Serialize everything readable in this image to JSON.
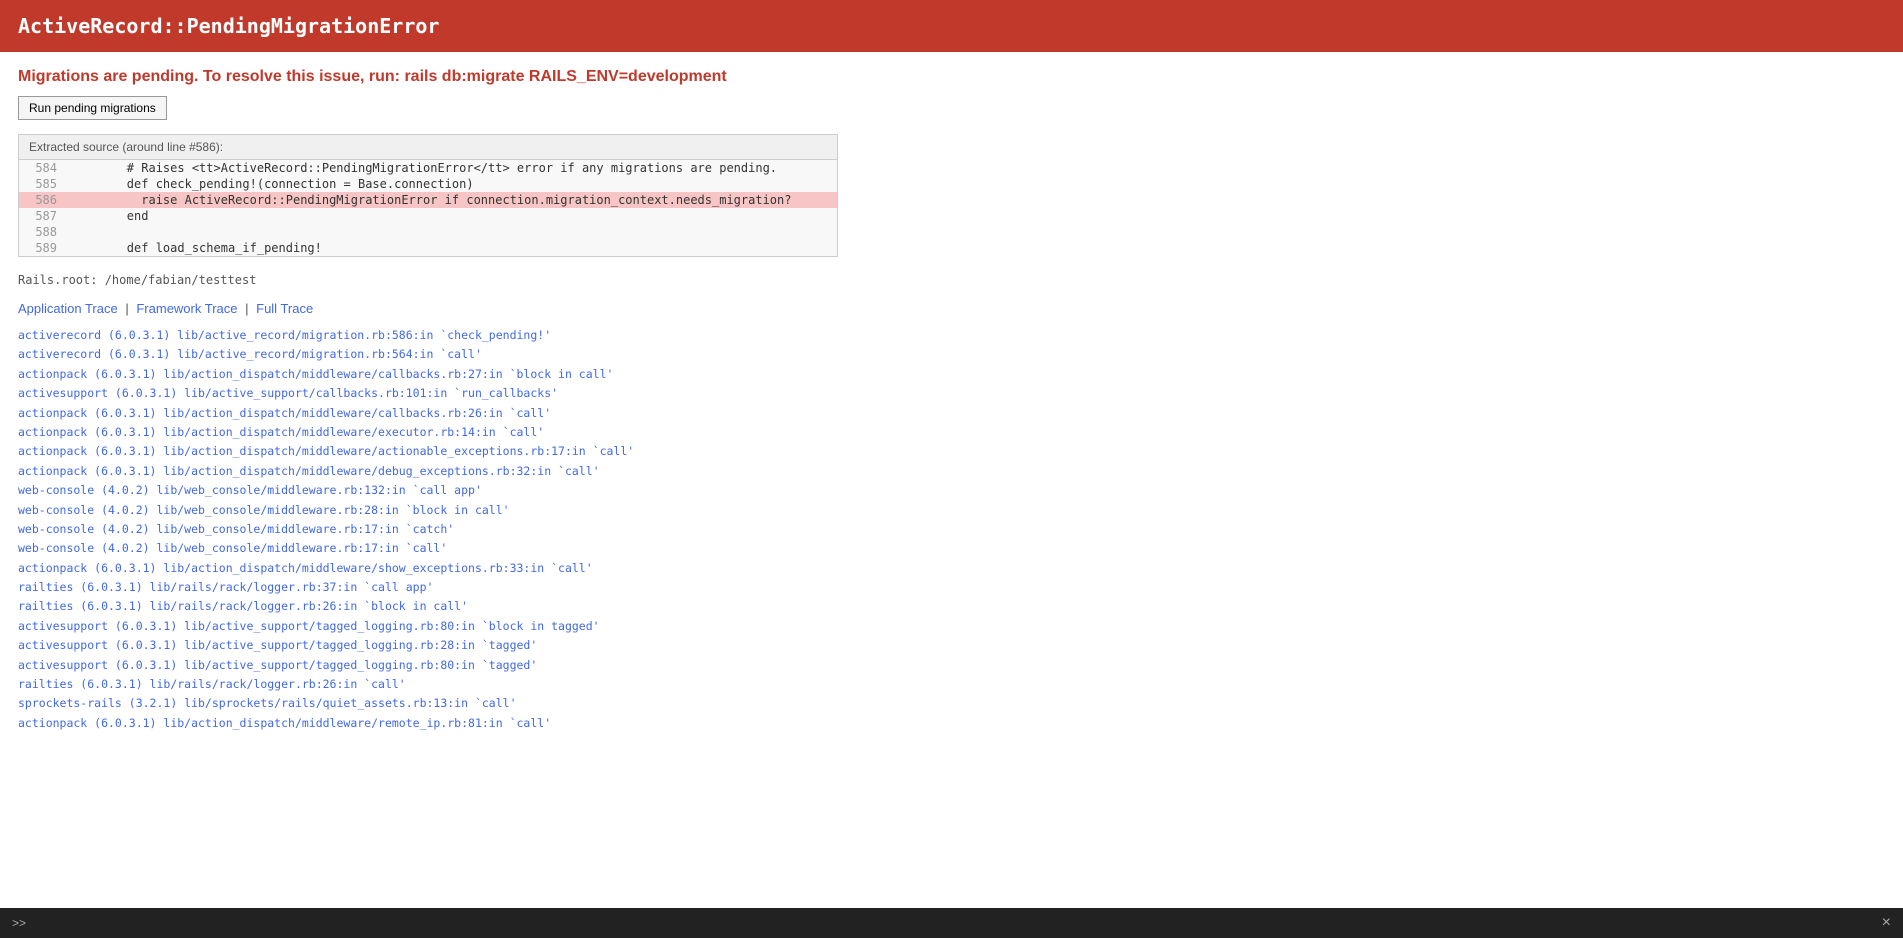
{
  "header": {
    "title": "ActiveRecord::PendingMigrationError"
  },
  "message": {
    "text": "Migrations are pending. To resolve this issue, run: rails db:migrate RAILS_ENV=development"
  },
  "button": {
    "label": "Run pending migrations"
  },
  "source": {
    "header": "Extracted source (around line #586):",
    "lines": [
      {
        "number": "584",
        "code": "        # Raises <tt>ActiveRecord::PendingMigrationError</tt> error if any migrations are pending.",
        "highlighted": false
      },
      {
        "number": "585",
        "code": "        def check_pending!(connection = Base.connection)",
        "highlighted": false
      },
      {
        "number": "586",
        "code": "          raise ActiveRecord::PendingMigrationError if connection.migration_context.needs_migration?",
        "highlighted": true
      },
      {
        "number": "587",
        "code": "        end",
        "highlighted": false
      },
      {
        "number": "588",
        "code": "",
        "highlighted": false
      },
      {
        "number": "589",
        "code": "        def load_schema_if_pending!",
        "highlighted": false
      }
    ]
  },
  "rails_root": "Rails.root: /home/fabian/testtest",
  "trace": {
    "links": [
      {
        "label": "Application Trace",
        "active": true
      },
      {
        "label": "Framework Trace",
        "active": false
      },
      {
        "label": "Full Trace",
        "active": false
      }
    ],
    "items": [
      "activerecord (6.0.3.1) lib/active_record/migration.rb:586:in `check_pending!'",
      "activerecord (6.0.3.1) lib/active_record/migration.rb:564:in `call'",
      "actionpack (6.0.3.1) lib/action_dispatch/middleware/callbacks.rb:27:in `block in call'",
      "activesupport (6.0.3.1) lib/active_support/callbacks.rb:101:in `run_callbacks'",
      "actionpack (6.0.3.1) lib/action_dispatch/middleware/callbacks.rb:26:in `call'",
      "actionpack (6.0.3.1) lib/action_dispatch/middleware/executor.rb:14:in `call'",
      "actionpack (6.0.3.1) lib/action_dispatch/middleware/actionable_exceptions.rb:17:in `call'",
      "actionpack (6.0.3.1) lib/action_dispatch/middleware/debug_exceptions.rb:32:in `call'",
      "web-console (4.0.2) lib/web_console/middleware.rb:132:in `call app'",
      "web-console (4.0.2) lib/web_console/middleware.rb:28:in `block in call'",
      "web-console (4.0.2) lib/web_console/middleware.rb:17:in `catch'",
      "web-console (4.0.2) lib/web_console/middleware.rb:17:in `call'",
      "actionpack (6.0.3.1) lib/action_dispatch/middleware/show_exceptions.rb:33:in `call'",
      "railties (6.0.3.1) lib/rails/rack/logger.rb:37:in `call app'",
      "railties (6.0.3.1) lib/rails/rack/logger.rb:26:in `block in call'",
      "activesupport (6.0.3.1) lib/active_support/tagged_logging.rb:80:in `block in tagged'",
      "activesupport (6.0.3.1) lib/active_support/tagged_logging.rb:28:in `tagged'",
      "activesupport (6.0.3.1) lib/active_support/tagged_logging.rb:80:in `tagged'",
      "railties (6.0.3.1) lib/rails/rack/logger.rb:26:in `call'",
      "sprockets-rails (3.2.1) lib/sprockets/rails/quiet_assets.rb:13:in `call'",
      "actionpack (6.0.3.1) lib/action_dispatch/middleware/remote_ip.rb:81:in `call'"
    ]
  },
  "footer": {
    "prompt": ">>",
    "close": "×"
  }
}
